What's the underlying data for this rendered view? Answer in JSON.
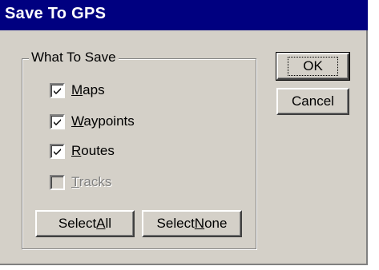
{
  "window": {
    "title": "Save To GPS"
  },
  "group": {
    "label": "What To Save"
  },
  "options": [
    {
      "pre": "",
      "accel": "M",
      "post": "aps",
      "checked": true,
      "enabled": true
    },
    {
      "pre": "",
      "accel": "W",
      "post": "aypoints",
      "checked": true,
      "enabled": true
    },
    {
      "pre": "",
      "accel": "R",
      "post": "outes",
      "checked": true,
      "enabled": true
    },
    {
      "pre": "",
      "accel": "T",
      "post": "racks",
      "checked": false,
      "enabled": false
    }
  ],
  "buttons": {
    "ok": "OK",
    "cancel": "Cancel",
    "select_all": {
      "pre": "Select ",
      "accel": "A",
      "post": "ll"
    },
    "select_none": {
      "pre": "Select ",
      "accel": "N",
      "post": "one"
    }
  }
}
